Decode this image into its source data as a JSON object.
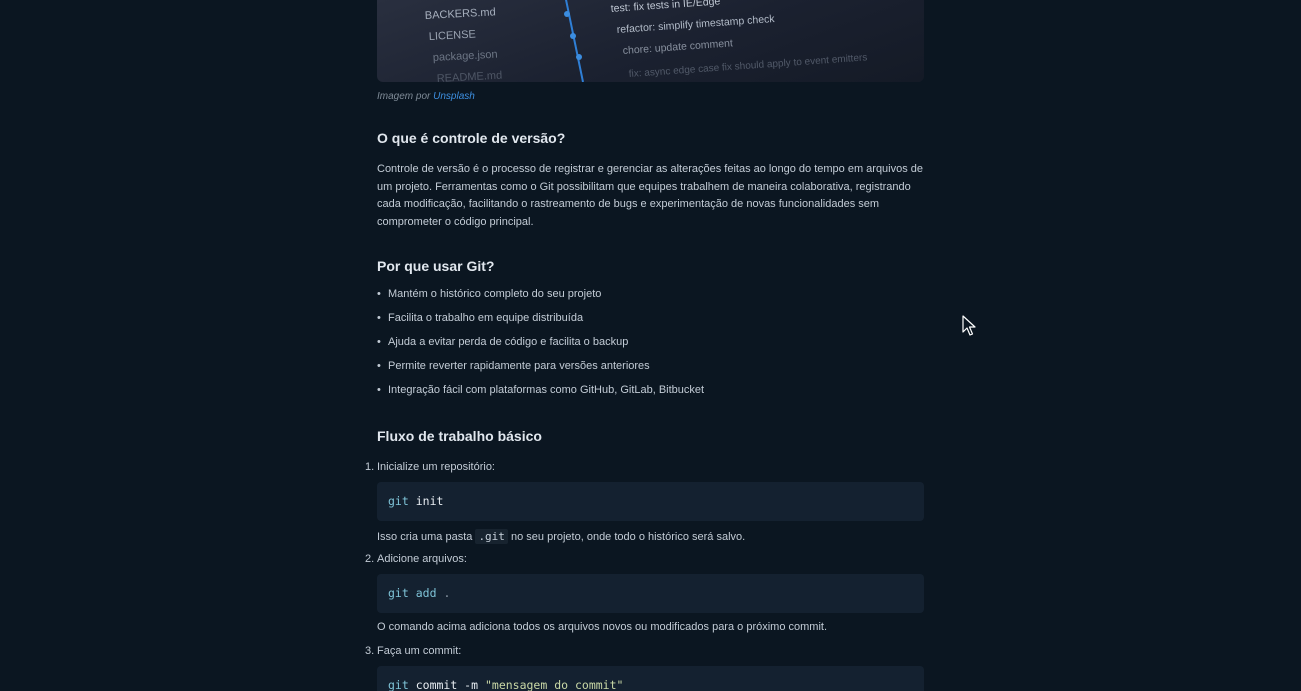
{
  "hero_image": {
    "file_list": [
      "BACKERS.md",
      "LICENSE",
      "package.json",
      "README.md"
    ],
    "commit_messages": [
      "test: fix tests in IE/Edge",
      "refactor: simplify timestamp check",
      "chore: update comment",
      "fix: async edge case fix should apply to event emitters"
    ],
    "caption_prefix": "Imagem por",
    "caption_link": "Unsplash"
  },
  "section_what": {
    "title": "O que é controle de versão?",
    "body": "Controle de versão é o processo de registrar e gerenciar as alterações feitas ao longo do tempo em arquivos de um projeto. Ferramentas como o Git possibilitam que equipes trabalhem de maneira colaborativa, registrando cada modificação, facilitando o rastreamento de bugs e experimentação de novas funcionalidades sem comprometer o código principal."
  },
  "section_why": {
    "title": "Por que usar Git?",
    "bullet": "•",
    "items": [
      "Mantém o histórico completo do seu projeto",
      "Facilita o trabalho em equipe distribuída",
      "Ajuda a evitar perda de código e facilita o backup",
      "Permite reverter rapidamente para versões anteriores",
      "Integração fácil com plataformas como GitHub, GitLab, Bitbucket"
    ]
  },
  "section_flow": {
    "title": "Fluxo de trabalho básico",
    "steps": [
      {
        "num": "1.",
        "label": "Inicialize um repositório:",
        "code_cmd": "git",
        "code_arg": "init",
        "note_before": "Isso cria uma pasta",
        "note_code": ".git",
        "note_after": "no seu projeto, onde todo o histórico será salvo."
      },
      {
        "num": "2.",
        "label": "Adicione arquivos:",
        "code_cmd": "git",
        "code_arg": "add",
        "code_extra": ".",
        "note": "O comando acima adiciona todos os arquivos novos ou modificados para o próximo commit."
      },
      {
        "num": "3.",
        "label": "Faça um commit:",
        "code_cmd": "git",
        "code_arg": "commit -m",
        "code_str": "\"mensagem do commit\""
      }
    ]
  },
  "colors": {
    "background": "#0b1621",
    "code_background": "#142130",
    "link": "#3d8fe0"
  }
}
